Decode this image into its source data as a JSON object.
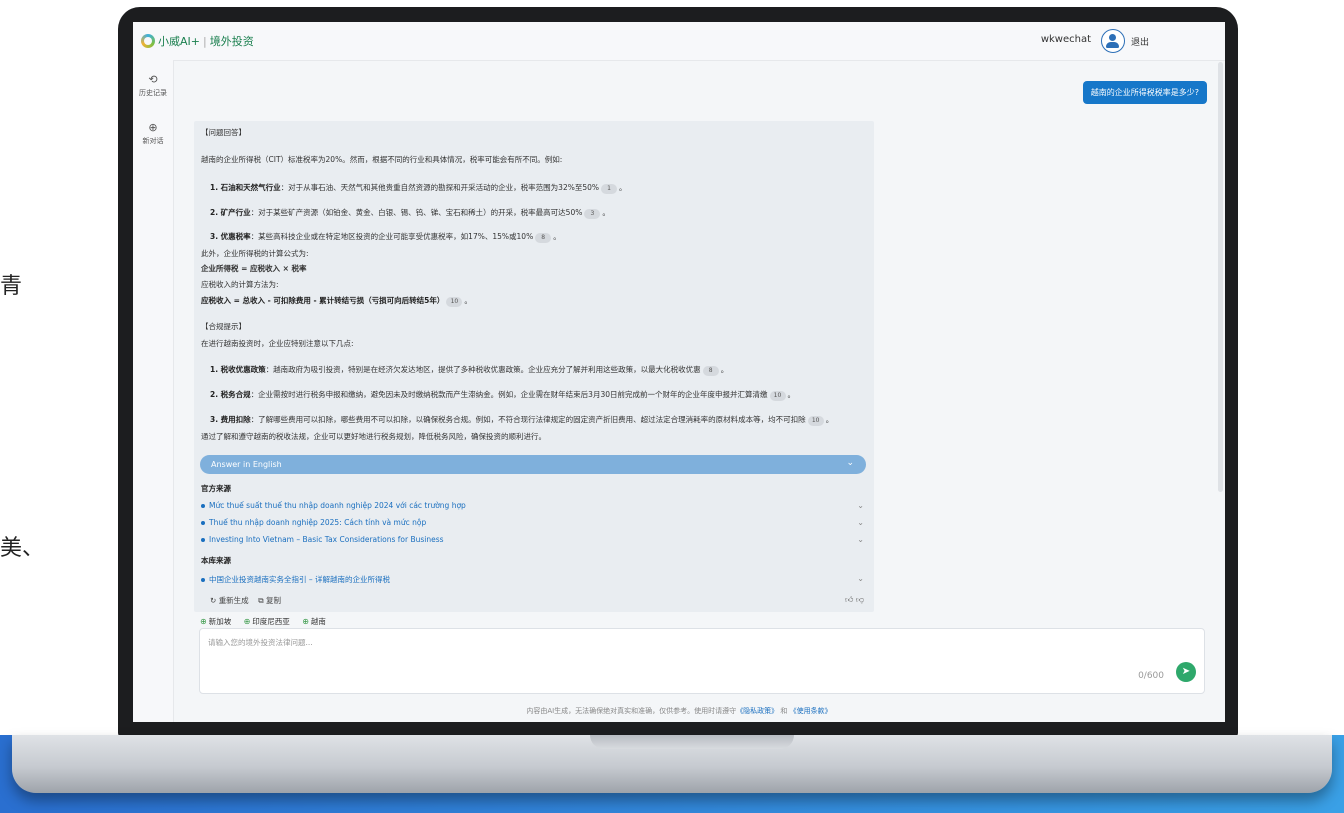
{
  "background": {
    "left_char1": "青",
    "left_char2": "美、"
  },
  "topbar": {
    "brand": "小威AI+",
    "section": "境外投资",
    "username": "wkwechat",
    "logout": "退出"
  },
  "sidebar": {
    "history": "历史记录",
    "new_chat": "新对话"
  },
  "user_question": "越南的企业所得税税率是多少?",
  "answer": {
    "section1_title": "【问题回答】",
    "intro": "越南的企业所得税（CIT）标准税率为20%。然而，根据不同的行业和具体情况，税率可能会有所不同。例如:",
    "item1_label": "1. 石油和天然气行业",
    "item1_text": "：对于从事石油、天然气和其他贵重自然资源的勘探和开采活动的企业，税率范围为32%至50%",
    "item1_cite": "1",
    "item2_label": "2. 矿产行业",
    "item2_text": "：对于某些矿产资源（如铂金、黄金、白银、锡、钨、锑、宝石和稀土）的开采，税率最高可达50%",
    "item2_cite": "3",
    "item3_label": "3. 优惠税率",
    "item3_text": "：某些高科技企业或在特定地区投资的企业可能享受优惠税率，如17%、15%或10%",
    "item3_cite": "8",
    "formula_intro": "此外，企业所得税的计算公式为:",
    "formula": "企业所得税 = 应税收入 × 税率",
    "taxable_intro": "应税收入的计算方法为:",
    "taxable_formula": "应税收入 = 总收入 - 可扣除费用 - 累计转结亏损（亏损可向后转结5年）",
    "taxable_cite": "10",
    "section2_title": "【合规提示】",
    "compliance_intro": "在进行越南投资时，企业应特别注意以下几点:",
    "c1_label": "1. 税收优惠政策",
    "c1_text": "：越南政府为吸引投资，特别是在经济欠发达地区，提供了多种税收优惠政策。企业应充分了解并利用这些政策，以最大化税收优惠",
    "c1_cite": "8",
    "c2_label": "2. 税务合规",
    "c2_text": "：企业需按时进行税务申报和缴纳，避免因未及时缴纳税款而产生滞纳金。例如，企业需在财年结束后3月30日前完成前一个财年的企业年度申报并汇算清缴",
    "c2_cite": "10",
    "c3_label": "3. 费用扣除",
    "c3_text": "：了解哪些费用可以扣除，哪些费用不可以扣除，以确保税务合规。例如，不符合现行法律规定的固定资产折旧费用、超过法定合理消耗率的原材料成本等，均不可扣除",
    "c3_cite": "10",
    "conclusion": "通过了解和遵守越南的税收法规，企业可以更好地进行税务规划，降低税务风险，确保投资的顺利进行。",
    "english_bar": "Answer in English",
    "official_sources_title": "官方来源",
    "official_sources": [
      "Mức thuế suất thuế thu nhập doanh nghiệp 2024 với các trường hợp",
      "Thuế thu nhập doanh nghiệp 2025: Cách tính và mức nộp",
      "Investing Into Vietnam – Basic Tax Considerations for Business"
    ],
    "library_sources_title": "本库来源",
    "library_sources": [
      "中国企业投资越南实务全指引 – 详解越南的企业所得税"
    ],
    "regenerate": "重新生成",
    "copy": "复制"
  },
  "regions": [
    "新加坡",
    "印度尼西亚",
    "越南"
  ],
  "input": {
    "placeholder": "请输入您的境外投资法律问题...",
    "counter": "0/600"
  },
  "footer": {
    "text": "内容由AI生成，无法确保绝对真实和准确，仅供参考。使用时请遵守",
    "privacy": "《隐私政策》",
    "and": "和",
    "terms": "《使用条款》"
  }
}
